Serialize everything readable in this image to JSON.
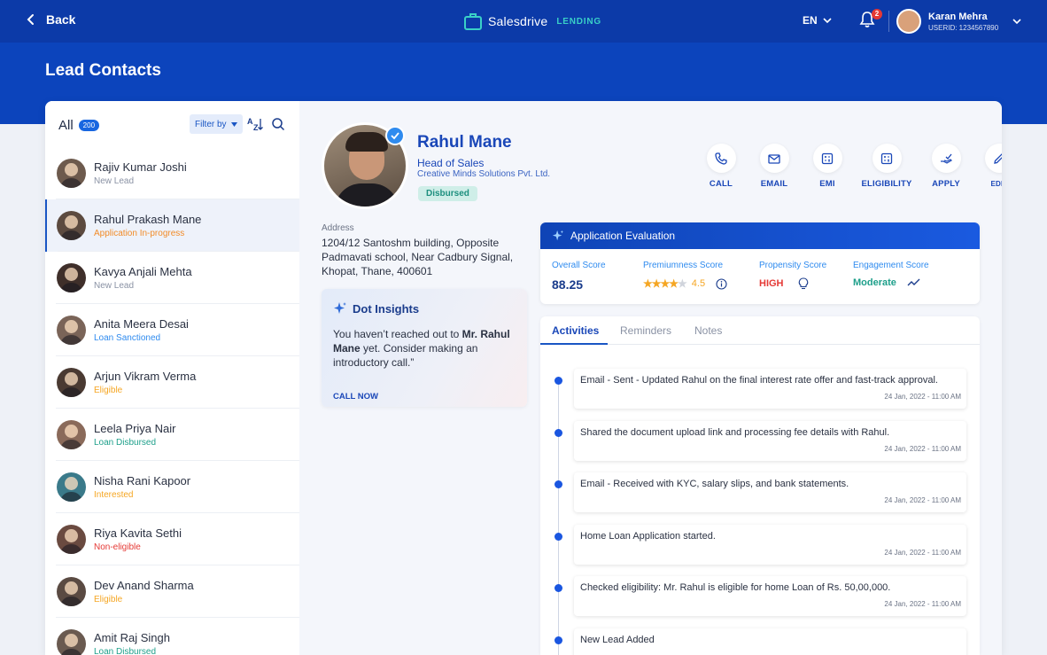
{
  "topbar": {
    "back_label": "Back",
    "brand": "Salesdrive",
    "brand_sub": "LENDING",
    "language": "EN",
    "notification_count": "2",
    "user_name": "Karan Mehra",
    "user_id": "USERID: 1234567890"
  },
  "page_title": "Lead Contacts",
  "sidebar": {
    "all_label": "All",
    "all_count": "200",
    "filter_label": "Filter by",
    "leads": [
      {
        "name": "Rajiv Kumar Joshi",
        "status": "New Lead",
        "status_color": "#8a92a4",
        "avatar_color": "#6d5a4d"
      },
      {
        "name": "Rahul Prakash Mane",
        "status": "Application In-progress",
        "status_color": "#f28c28",
        "avatar_color": "#5c4a3f"
      },
      {
        "name": "Kavya Anjali Mehta",
        "status": "New Lead",
        "status_color": "#8a92a4",
        "avatar_color": "#3f2f2a"
      },
      {
        "name": "Anita Meera Desai",
        "status": "Loan Sanctioned",
        "status_color": "#2f8bef",
        "avatar_color": "#7a6458"
      },
      {
        "name": "Arjun Vikram Verma",
        "status": "Eligible",
        "status_color": "#f5a623",
        "avatar_color": "#4a3a32"
      },
      {
        "name": "Leela Priya Nair",
        "status": "Loan Disbursed",
        "status_color": "#1d9f8a",
        "avatar_color": "#8a6a5a"
      },
      {
        "name": "Nisha Rani Kapoor",
        "status": "Interested",
        "status_color": "#f5a623",
        "avatar_color": "#3a7a8a"
      },
      {
        "name": "Riya Kavita Sethi",
        "status": "Non-eligible",
        "status_color": "#e53935",
        "avatar_color": "#6a4a40"
      },
      {
        "name": "Dev Anand Sharma",
        "status": "Eligible",
        "status_color": "#f5a623",
        "avatar_color": "#5a4a42"
      },
      {
        "name": "Amit Raj Singh",
        "status": "Loan Disbursed",
        "status_color": "#1d9f8a",
        "avatar_color": "#6a5a50"
      }
    ]
  },
  "profile": {
    "name": "Rahul Mane",
    "role": "Head of Sales",
    "company": "Creative Minds Solutions Pvt. Ltd.",
    "badge": "Disbursed",
    "address_label": "Address",
    "address": "1204/12 Santoshm building, Opposite Padmavati school, Near Cadbury Signal, Khopat, Thane, 400601"
  },
  "actions": {
    "call": "CALL",
    "email": "EMAIL",
    "emi": "EMI",
    "eligibility": "ELIGIBILITY",
    "apply": "APPLY",
    "edit": "EDIT"
  },
  "insights": {
    "title": "Dot Insights",
    "text_pre": "You haven’t reached out to ",
    "text_bold": "Mr. Rahul Mane",
    "text_post": " yet. Consider making an introductory call.”",
    "cta": "CALL NOW"
  },
  "evaluation": {
    "title": "Application Evaluation",
    "overall_label": "Overall Score",
    "overall_value": "88.25",
    "premium_label": "Premiumness Score",
    "premium_value": "4.5",
    "premium_stars": 4.5,
    "propensity_label": "Propensity Score",
    "propensity_value": "HIGH",
    "engagement_label": "Engagement Score",
    "engagement_value": "Moderate"
  },
  "tabs": [
    "Activities",
    "Reminders",
    "Notes"
  ],
  "activities": [
    {
      "text": "Email - Sent - Updated Rahul on the final interest rate offer and fast-track approval.",
      "date": "24 Jan, 2022 - 11:00 AM"
    },
    {
      "text": "Shared the document upload link and processing fee details with Rahul.",
      "date": "24 Jan, 2022 - 11:00 AM"
    },
    {
      "text": "Email - Received with KYC, salary slips, and bank statements.",
      "date": "24 Jan, 2022 - 11:00 AM"
    },
    {
      "text": "Home Loan Application started.",
      "date": "24 Jan, 2022 - 11:00 AM"
    },
    {
      "text": "Checked eligibility: Mr. Rahul is eligible for home Loan of Rs. 50,00,000.",
      "date": "24 Jan, 2022 - 11:00 AM"
    },
    {
      "text": "New Lead Added",
      "date": ""
    }
  ],
  "colors": {
    "brand_dark": "#0c3aa8",
    "brand": "#1a47b8",
    "accent_teal": "#3ad0c7",
    "high": "#e53935",
    "moderate": "#1d9f8a",
    "star": "#f5a623"
  }
}
